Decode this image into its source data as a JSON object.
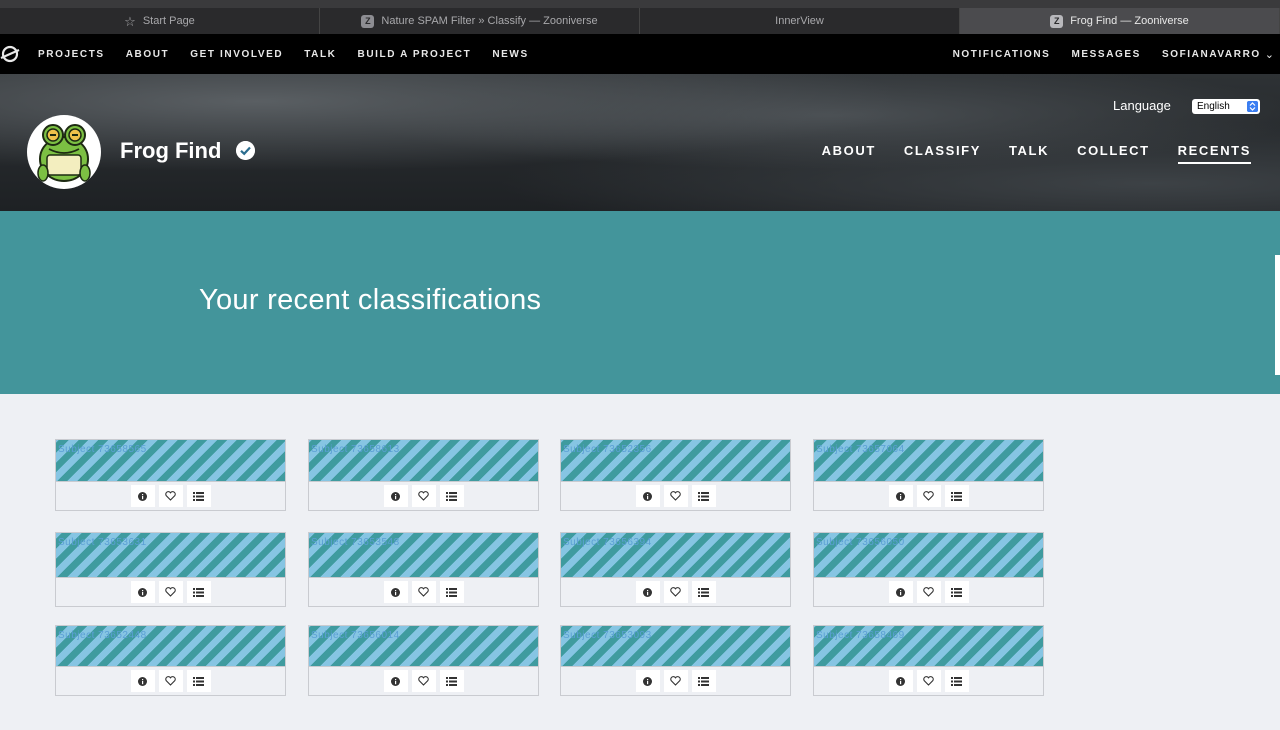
{
  "browser": {
    "tabs": [
      {
        "label": "Start Page",
        "icon": "star-icon",
        "active": false
      },
      {
        "label": "Nature SPAM Filter » Classify — Zooniverse",
        "icon": "zooniverse-favicon",
        "active": false
      },
      {
        "label": "InnerView",
        "icon": "",
        "active": false
      },
      {
        "label": "Frog Find — Zooniverse",
        "icon": "zooniverse-favicon",
        "active": true
      }
    ]
  },
  "zoonav": {
    "links": [
      "PROJECTS",
      "ABOUT",
      "GET INVOLVED",
      "TALK",
      "BUILD A PROJECT",
      "NEWS"
    ],
    "notifications": "NOTIFICATIONS",
    "messages": "MESSAGES",
    "user": "SOFIANAVARRO"
  },
  "project": {
    "title": "Frog Find",
    "language_label": "Language",
    "language_value": "English",
    "nav": [
      {
        "label": "ABOUT",
        "active": false
      },
      {
        "label": "CLASSIFY",
        "active": false
      },
      {
        "label": "TALK",
        "active": false
      },
      {
        "label": "COLLECT",
        "active": false
      },
      {
        "label": "RECENTS",
        "active": true
      }
    ]
  },
  "banner": {
    "heading": "Your recent classifications"
  },
  "recents": {
    "subjects": [
      {
        "label": "Subject 73658565"
      },
      {
        "label": "Subject 73658613"
      },
      {
        "label": "Subject 73652356"
      },
      {
        "label": "Subject 73657064"
      },
      {
        "label": "Subject 73653631"
      },
      {
        "label": "Subject 73653548"
      },
      {
        "label": "Subject 73656394"
      },
      {
        "label": "Subject 73656050"
      },
      {
        "label": "Subject 73652448"
      },
      {
        "label": "Subject 73656014"
      },
      {
        "label": "Subject 73653093"
      },
      {
        "label": "Subject 73658469"
      }
    ],
    "tool_icons": [
      "info-icon",
      "heart-icon",
      "list-icon"
    ]
  },
  "colors": {
    "banner": "#43959b",
    "nav_bg": "#000000",
    "accent_select": "#3b7ef1"
  }
}
